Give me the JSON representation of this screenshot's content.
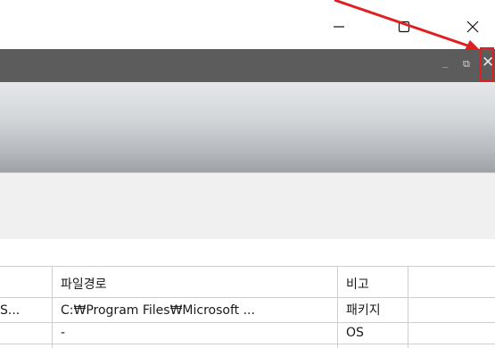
{
  "window": {
    "minimize_glyph": "–",
    "maximize_glyph": "☐",
    "close_glyph": "✕"
  },
  "inner_window": {
    "minimize_glyph": "_",
    "restore_glyph": "⧉",
    "close_glyph": "✕"
  },
  "grid": {
    "columns": [
      "",
      "파일경로",
      "비고"
    ],
    "rows": [
      {
        "name": "S...",
        "path": "C:₩Program Files₩Microsoft ...",
        "note": "패키지"
      },
      {
        "name": "",
        "path": "-",
        "note": "OS"
      }
    ]
  },
  "colors": {
    "highlight": "#e02020",
    "inner_titlebar": "#5c5c5c"
  }
}
